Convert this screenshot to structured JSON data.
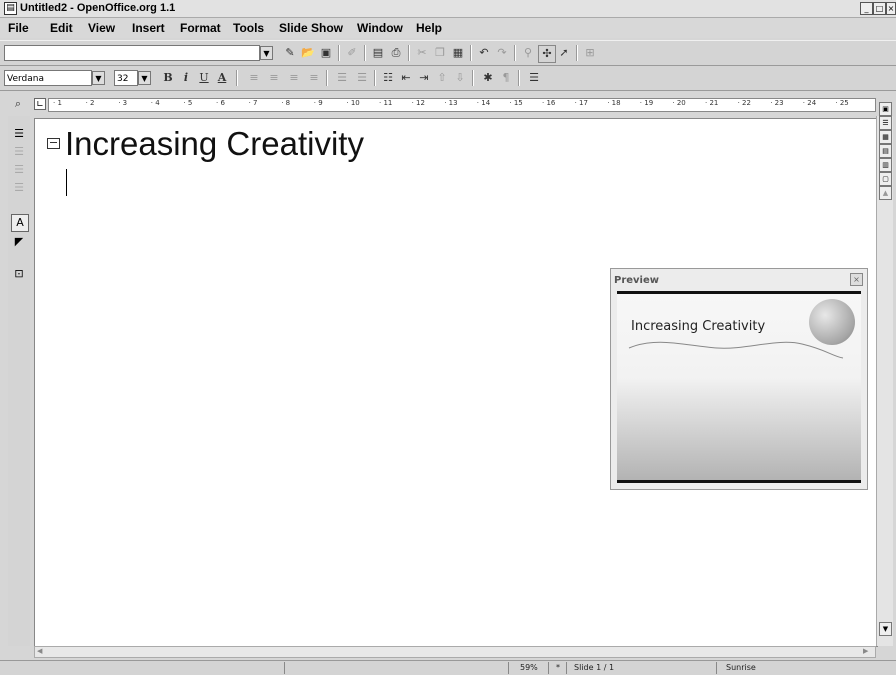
{
  "window": {
    "title": "Untitled2 - OpenOffice.org 1.1",
    "app_icon": "document-icon",
    "buttons": [
      "minimize-icon",
      "maximize-icon",
      "close-icon"
    ]
  },
  "menu": {
    "items": [
      "File",
      "Edit",
      "View",
      "Insert",
      "Format",
      "Tools",
      "Slide Show",
      "Window",
      "Help"
    ]
  },
  "toolbar1": {
    "url_value": "",
    "icons": [
      "edit-file-icon",
      "open-icon",
      "save-icon",
      "edit-doc-icon",
      "export-pdf-icon",
      "print-icon",
      "cut-icon",
      "copy-icon",
      "paste-icon",
      "undo-icon",
      "redo-icon",
      "hyperlink-icon",
      "navigator-icon",
      "gallery-icon",
      "data-sources-icon"
    ]
  },
  "toolbar2": {
    "font_name": "Verdana",
    "font_size": "32",
    "bold": "B",
    "italic": "i",
    "underline": "U",
    "font_color": "A"
  },
  "ruler": {
    "ticks": [
      "1",
      "2",
      "3",
      "4",
      "5",
      "6",
      "7",
      "8",
      "9",
      "10",
      "11",
      "12",
      "13",
      "14",
      "15",
      "16",
      "17",
      "18",
      "19",
      "20",
      "21",
      "22",
      "23",
      "24",
      "25"
    ]
  },
  "slide": {
    "title": "Increasing Creativity"
  },
  "preview": {
    "title": "Preview",
    "slide_title": "Increasing Creativity"
  },
  "statusbar": {
    "zoom": "59%",
    "modified": "*",
    "slide": "Slide 1 / 1",
    "layout": "Sunrise"
  }
}
